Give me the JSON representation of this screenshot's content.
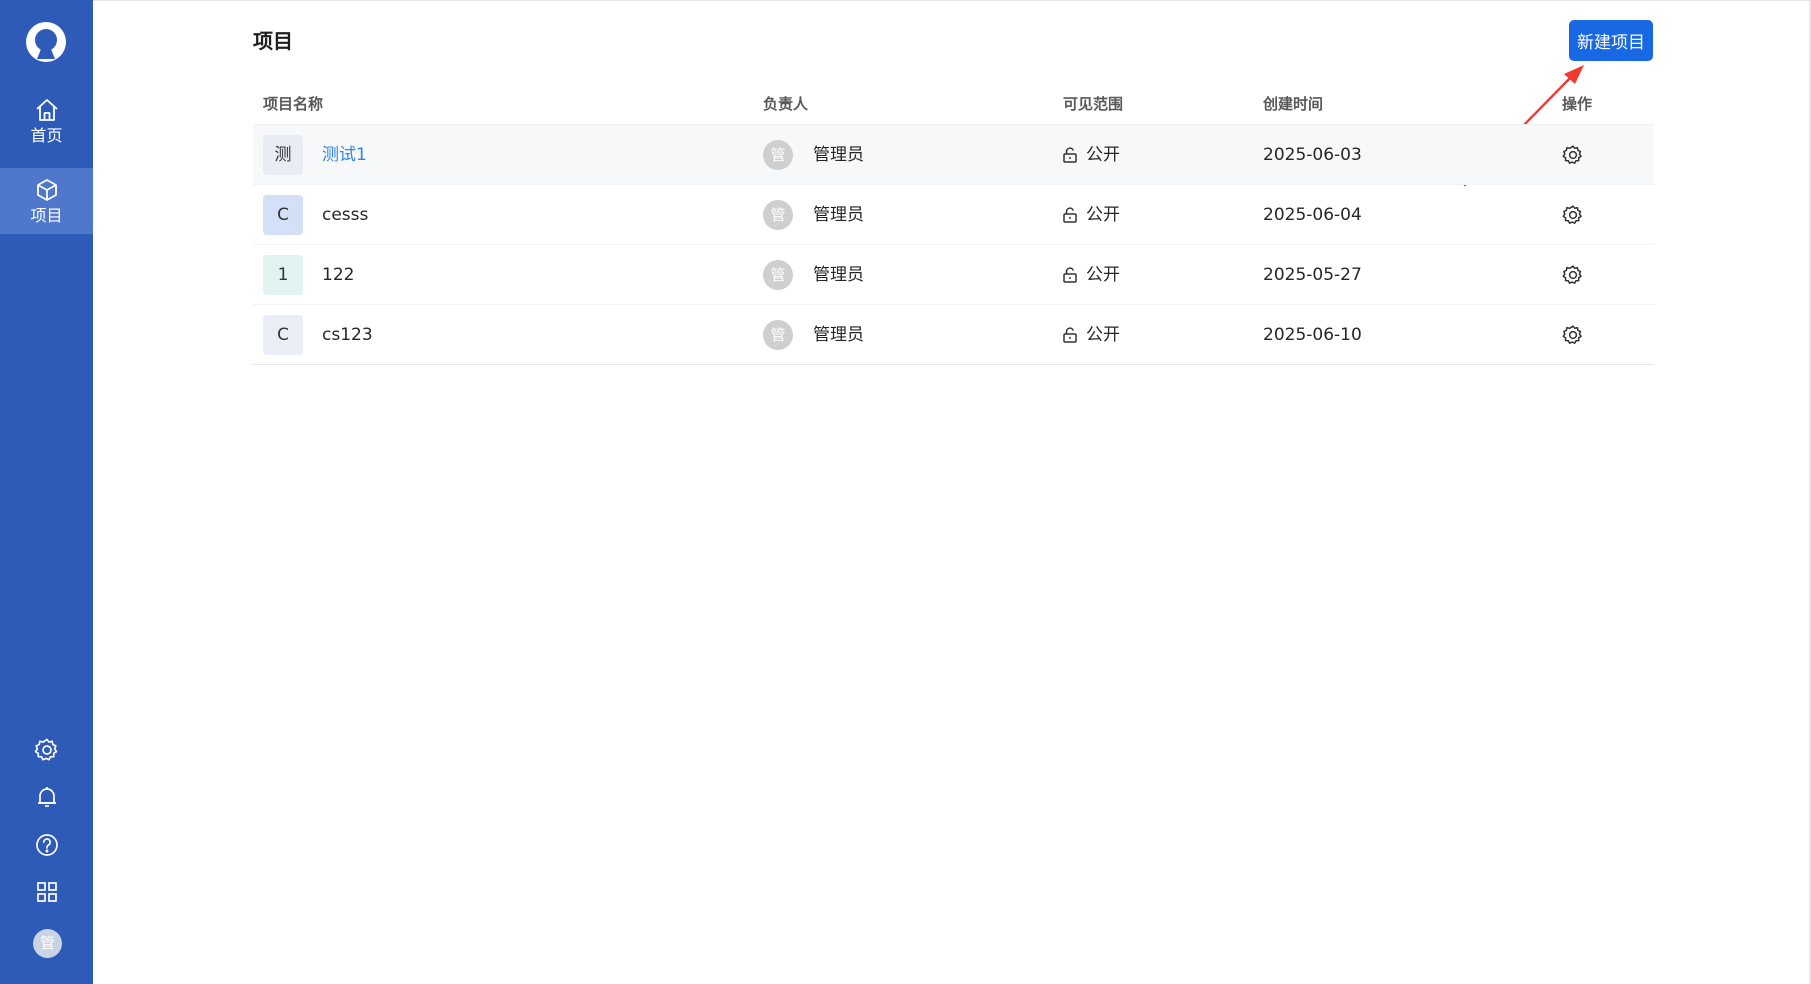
{
  "sidebar": {
    "nav": [
      {
        "label": "首页",
        "icon": "home-icon"
      },
      {
        "label": "项目",
        "icon": "cube-icon"
      }
    ],
    "bottom_icons": [
      "gear-icon",
      "bell-icon",
      "help-icon",
      "apps-grid-icon"
    ],
    "avatar_text": "管",
    "background": "#2e5bb8",
    "active_background": "#4f78cc"
  },
  "header": {
    "title": "项目",
    "new_button_label": "新建项目",
    "accent": "#1867e3"
  },
  "table": {
    "columns": [
      "项目名称",
      "负责人",
      "可见范围",
      "创建时间",
      "操作"
    ],
    "rows": [
      {
        "badge": "测",
        "badge_color": "#e8ecf5",
        "name": "测试1",
        "name_is_link": true,
        "owner_avatar": "管",
        "owner": "管理员",
        "visibility": "公开",
        "created": "2025-06-03"
      },
      {
        "badge": "C",
        "badge_color": "#d3e0f7",
        "name": "cesss",
        "name_is_link": false,
        "owner_avatar": "管",
        "owner": "管理员",
        "visibility": "公开",
        "created": "2025-06-04"
      },
      {
        "badge": "1",
        "badge_color": "#e0f3f1",
        "name": "122",
        "name_is_link": false,
        "owner_avatar": "管",
        "owner": "管理员",
        "visibility": "公开",
        "created": "2025-05-27"
      },
      {
        "badge": "C",
        "badge_color": "#eceef7",
        "name": "cs123",
        "name_is_link": false,
        "owner_avatar": "管",
        "owner": "管理员",
        "visibility": "公开",
        "created": "2025-06-10"
      }
    ]
  }
}
